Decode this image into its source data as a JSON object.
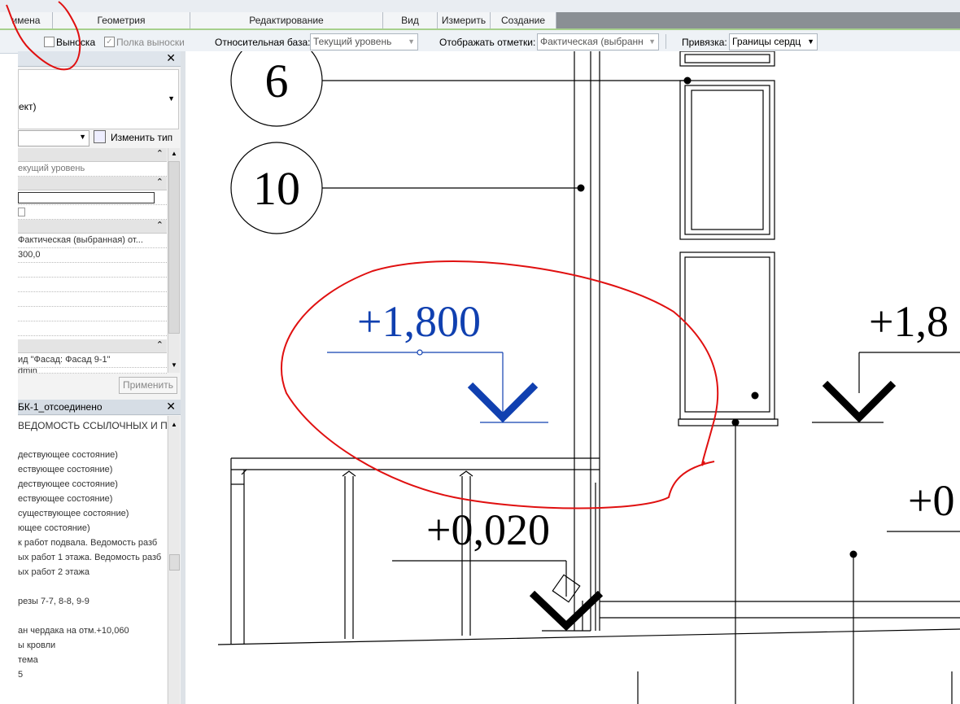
{
  "ribbon_tabs": [
    "имена",
    "Геометрия",
    "Редактирование",
    "Вид",
    "Измерить",
    "Создание"
  ],
  "options_bar": {
    "leader_label": "Выноска",
    "shoulder_label": "Полка выноски",
    "relative_base_label": "Относительная база:",
    "relative_base_value": "Текущий уровень",
    "display_elev_label": "Отображать отметки:",
    "display_elev_value": "Фактическая (выбранн",
    "snap_label": "Привязка:",
    "snap_value": "Границы сердц"
  },
  "properties": {
    "type_text": "ект)",
    "edit_type_label": "Изменить тип",
    "rows": [
      "екущий уровень",
      "Фактическая (выбранная) от...",
      "300,0"
    ],
    "view_text": "ид \"Фасад: Фасад 9-1\"",
    "admin_text": "dmin",
    "apply_label": "Применить"
  },
  "browser": {
    "title": "БК-1_отсоединено",
    "header": "ВЕДОМОСТЬ ССЫЛОЧНЫХ И ПР",
    "items": [
      "дествующее состояние)",
      "ествующее состояние)",
      "дествующее состояние)",
      "ествующее состояние)",
      "существующее состояние)",
      "ющее состояние)",
      "к работ подвала. Ведомость разб",
      "ых работ 1 этажа. Ведомость разб",
      "ых работ 2 этажа",
      "",
      "резы 7-7, 8-8, 9-9",
      "",
      "ан чердака на отм.+10,060",
      "ы кровли",
      "тема",
      "5"
    ]
  },
  "drawing": {
    "tag_6": "6",
    "tag_10": "10",
    "elev_selected": "+1,800",
    "elev_right": "+1,8",
    "elev_floor": "+0,020",
    "elev_right_floor": "+0",
    "selected_color": "#1040b0",
    "markup_color": "#e01010"
  }
}
